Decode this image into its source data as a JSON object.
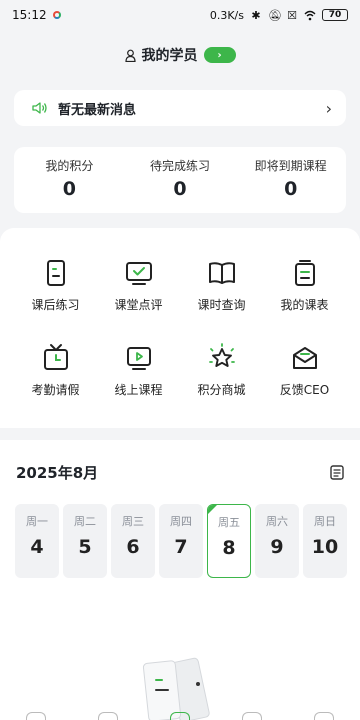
{
  "status_bar": {
    "time": "15:12",
    "speed": "0.3K/s",
    "battery": "70",
    "icons": [
      "bluetooth-icon",
      "mute-icon",
      "close-box-icon",
      "wifi-icon"
    ]
  },
  "header": {
    "title": "我的学员",
    "accent": "#3db64a"
  },
  "notice": {
    "text": "暂无最新消息"
  },
  "stats": [
    {
      "label": "我的积分",
      "value": "0"
    },
    {
      "label": "待完成练习",
      "value": "0"
    },
    {
      "label": "即将到期课程",
      "value": "0"
    }
  ],
  "grid": [
    {
      "label": "课后练习",
      "icon": "homework-icon"
    },
    {
      "label": "课堂点评",
      "icon": "comment-monitor-icon"
    },
    {
      "label": "课时查询",
      "icon": "book-icon"
    },
    {
      "label": "我的课表",
      "icon": "schedule-icon"
    },
    {
      "label": "考勤请假",
      "icon": "tv-clock-icon"
    },
    {
      "label": "线上课程",
      "icon": "play-screen-icon"
    },
    {
      "label": "积分商城",
      "icon": "star-icon"
    },
    {
      "label": "反馈CEO",
      "icon": "mail-icon"
    }
  ],
  "calendar": {
    "title": "2025年8月",
    "days": [
      {
        "name": "周一",
        "num": "4"
      },
      {
        "name": "周二",
        "num": "5"
      },
      {
        "name": "周三",
        "num": "6"
      },
      {
        "name": "周四",
        "num": "7"
      },
      {
        "name": "周五",
        "num": "8"
      },
      {
        "name": "周六",
        "num": "9"
      },
      {
        "name": "周日",
        "num": "10"
      }
    ],
    "selected_day": "8"
  }
}
